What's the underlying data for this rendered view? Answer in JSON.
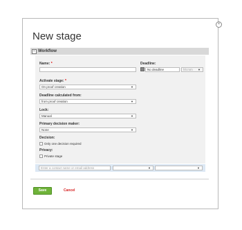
{
  "dialog": {
    "title": "New stage",
    "close_symbol": "×"
  },
  "workflow": {
    "header": "Workflow",
    "collapse_symbol": "−",
    "name": {
      "label": "Name:",
      "required_mark": "*",
      "value": ""
    },
    "deadline": {
      "label": "Deadline:",
      "value": "No deadline",
      "time_placeholder": "hh:mm",
      "icon": "calendar-icon"
    },
    "activate_stage": {
      "label": "Activate stage:",
      "required_mark": "*",
      "value": "On proof creation"
    },
    "deadline_calculated_from": {
      "label": "Deadline calculated from:",
      "value": "from proof creation"
    },
    "lock": {
      "label": "Lock:",
      "value": "Manual"
    },
    "primary_decision_maker": {
      "label": "Primary decision maker:",
      "value": "None"
    },
    "decision": {
      "label": "Decision:",
      "checkbox_label": "Only one decision required",
      "checked": false
    },
    "privacy": {
      "label": "Privacy:",
      "checkbox_label": "Private stage",
      "checked": false
    },
    "contact": {
      "placeholder": "Enter a contact name or email address",
      "select1_value": "",
      "select2_value": ""
    },
    "caret_symbol": "▼"
  },
  "actions": {
    "save_label": "Save",
    "cancel_label": "Cancel"
  },
  "colors": {
    "save_button": "#6fb33a",
    "cancel_link": "#d62020",
    "section_header": "#d8d8d8",
    "contact_row": "#dce8f4"
  }
}
